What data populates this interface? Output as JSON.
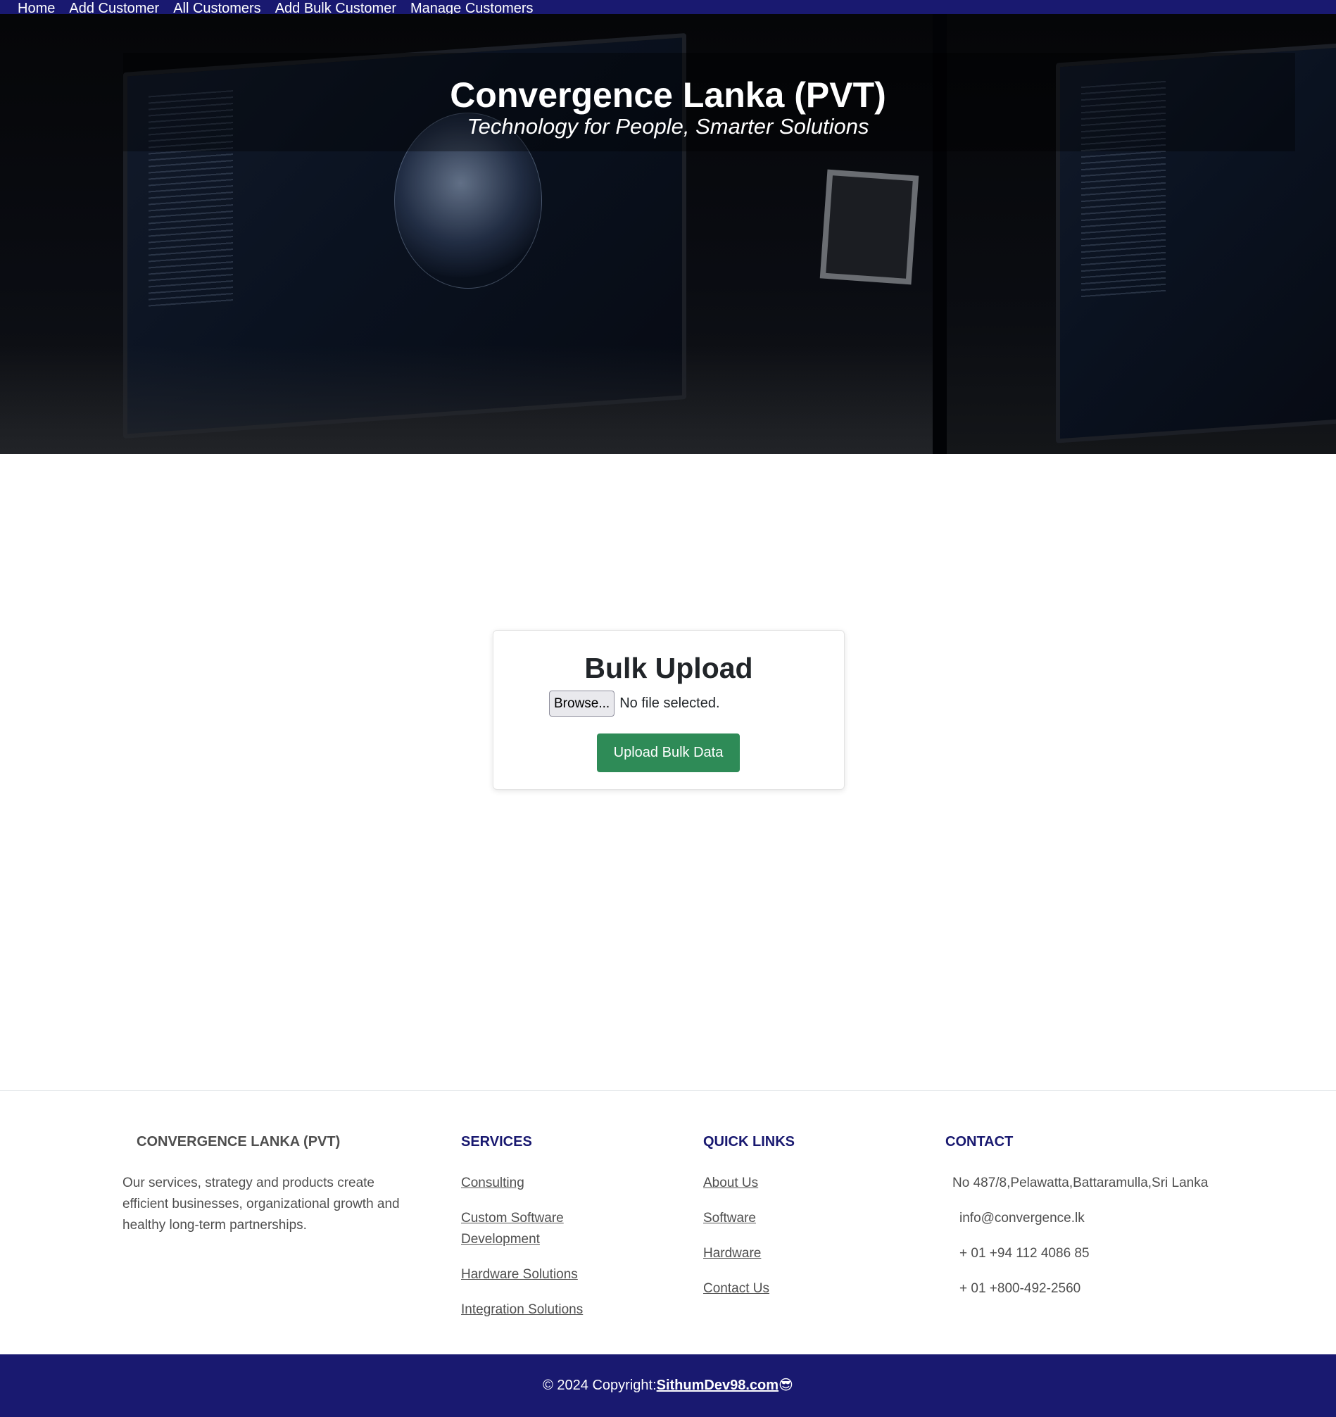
{
  "nav": {
    "items": [
      {
        "label": "Home"
      },
      {
        "label": "Add Customer"
      },
      {
        "label": "All Customers"
      },
      {
        "label": "Add Bulk Customer"
      },
      {
        "label": "Manage Customers"
      }
    ]
  },
  "hero": {
    "title": "Convergence Lanka (PVT)",
    "subtitle": "Technology for People, Smarter Solutions"
  },
  "upload_card": {
    "title": "Bulk Upload",
    "browse_label": "Browse...",
    "file_status": "No file selected.",
    "submit_label": "Upload Bulk Data"
  },
  "footer": {
    "brand": {
      "heading": "CONVERGENCE LANKA (PVT)",
      "description": "Our services, strategy and products create efficient businesses, organizational growth and healthy long-term partnerships."
    },
    "services": {
      "heading": "SERVICES",
      "links": [
        "Consulting",
        "Custom Software Development",
        "Hardware Solutions",
        "Integration Solutions"
      ]
    },
    "quick_links": {
      "heading": "QUICK LINKS",
      "links": [
        "About Us",
        "Software",
        "Hardware",
        "Contact Us"
      ]
    },
    "contact": {
      "heading": "CONTACT",
      "address": "No 487/8,Pelawatta,Battaramulla,Sri Lanka",
      "email": "info@convergence.lk",
      "phone_1": "+ 01 +94 112 4086 85",
      "phone_2": "+ 01 +800-492-2560"
    }
  },
  "copyright": {
    "prefix": "© 2024 Copyright:",
    "link": "SithumDev98.com",
    "emoji": "😎"
  },
  "colors": {
    "nav_bg": "#191970",
    "button_green": "#2e8b57",
    "footer_heading": "#191970"
  }
}
